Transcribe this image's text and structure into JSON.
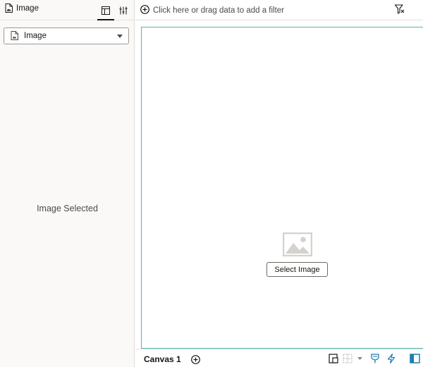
{
  "left_panel": {
    "title": "Image",
    "title_icon": "image-file-icon",
    "tabs": [
      {
        "name": "grammar",
        "icon": "grammar-panel-icon",
        "active": true
      },
      {
        "name": "properties",
        "icon": "sliders-icon",
        "active": false
      }
    ],
    "viz_type": {
      "label": "Image",
      "icon": "image-file-icon"
    },
    "empty_message": "Image Selected"
  },
  "filter_bar": {
    "placeholder": "Click here or drag data to add a filter",
    "add_icon": "plus-circle-icon",
    "filter_icon": "filter-icon"
  },
  "canvas": {
    "placeholder_icon": "image-placeholder-icon",
    "select_button_label": "Select Image"
  },
  "bottom_bar": {
    "canvas_tab": "Canvas 1",
    "icons": [
      "plus-circle-icon",
      "layout-icon",
      "grid-icon",
      "chevron-down-icon",
      "pin-icon",
      "bolt-icon",
      "panel-toggle-icon"
    ]
  },
  "colors": {
    "accent_teal": "#52b4b0",
    "panel_bg": "#faf9f8",
    "accent_blue": "#1c7eb0"
  }
}
